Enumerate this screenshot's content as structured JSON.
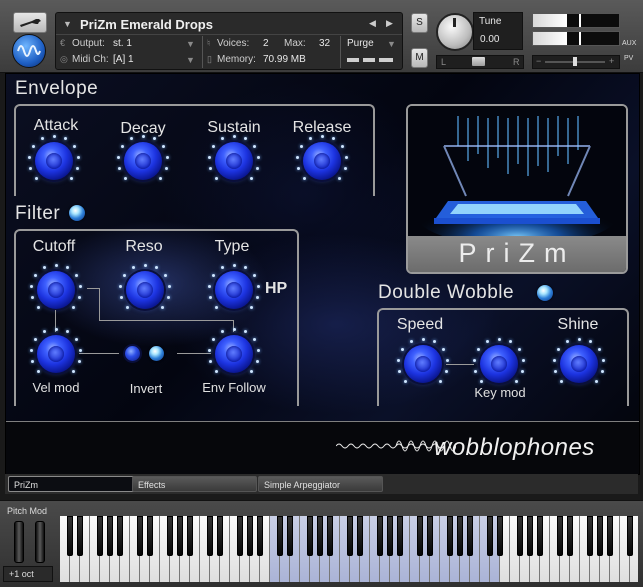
{
  "header": {
    "instrument_name": "PriZm Emerald Drops",
    "output_label": "Output:",
    "output_value": "st. 1",
    "voices_label": "Voices:",
    "voices_value": "2",
    "max_label": "Max:",
    "max_value": "32",
    "purge_label": "Purge",
    "midi_label": "Midi Ch:",
    "midi_value": "[A]  1",
    "memory_label": "Memory:",
    "memory_value": "70.99 MB",
    "solo_label": "S",
    "mute_label": "M",
    "tune_label": "Tune",
    "tune_value": "0.00",
    "pan_left": "L",
    "pan_right": "R",
    "aux_label": "AUX",
    "pv_label": "PV",
    "meter_minus": "−",
    "meter_plus": "+"
  },
  "envelope": {
    "title": "Envelope",
    "knobs": [
      {
        "label": "Attack"
      },
      {
        "label": "Decay"
      },
      {
        "label": "Sustain"
      },
      {
        "label": "Release"
      }
    ]
  },
  "filter": {
    "title": "Filter",
    "cutoff_label": "Cutoff",
    "reso_label": "Reso",
    "type_label": "Type",
    "type_value": "HP",
    "velmod_label": "Vel mod",
    "invert_label": "Invert",
    "envfollow_label": "Env Follow"
  },
  "wobble": {
    "title": "Double Wobble",
    "speed_label": "Speed",
    "shine_label": "Shine",
    "keymod_label": "Key mod"
  },
  "logo": {
    "prizm_text": "PriZm",
    "brand_text": "wobblophones"
  },
  "tabs": [
    {
      "label": "PriZm",
      "active": true
    },
    {
      "label": "Effects",
      "active": false
    },
    {
      "label": "Simple Arpeggiator",
      "active": false
    }
  ],
  "keyboard": {
    "pitch_mod_label": "Pitch Mod",
    "octave_label": "+1 oct"
  },
  "colors": {
    "knob_blue": "#1c33e0",
    "frame_gray": "#9a9a9a",
    "background": "#05060f"
  }
}
